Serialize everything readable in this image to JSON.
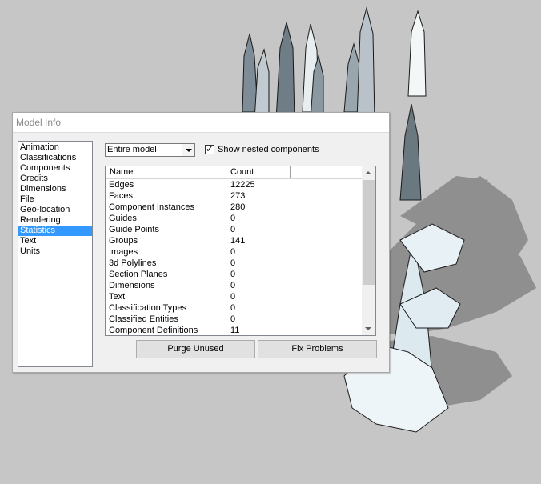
{
  "dialog": {
    "title": "Model Info",
    "sidebar": {
      "items": [
        "Animation",
        "Classifications",
        "Components",
        "Credits",
        "Dimensions",
        "File",
        "Geo-location",
        "Rendering",
        "Statistics",
        "Text",
        "Units"
      ],
      "selected": "Statistics"
    },
    "scope_select": {
      "value": "Entire model"
    },
    "nested_checkbox": {
      "label": "Show nested components",
      "checked": true
    },
    "table": {
      "headers": [
        "Name",
        "Count",
        ""
      ],
      "rows": [
        {
          "name": "Edges",
          "count": "12225"
        },
        {
          "name": "Faces",
          "count": "273"
        },
        {
          "name": "Component Instances",
          "count": "280"
        },
        {
          "name": "Guides",
          "count": "0"
        },
        {
          "name": "Guide Points",
          "count": "0"
        },
        {
          "name": "Groups",
          "count": "141"
        },
        {
          "name": "Images",
          "count": "0"
        },
        {
          "name": "3d Polylines",
          "count": "0"
        },
        {
          "name": "Section Planes",
          "count": "0"
        },
        {
          "name": "Dimensions",
          "count": "0"
        },
        {
          "name": "Text",
          "count": "0"
        },
        {
          "name": "Classification Types",
          "count": "0"
        },
        {
          "name": "Classified Entities",
          "count": "0"
        },
        {
          "name": "Component Definitions",
          "count": "11"
        }
      ]
    },
    "buttons": {
      "purge": "Purge Unused",
      "fix": "Fix Problems"
    }
  },
  "colors": {
    "viewport_bg": "#c6c6c6",
    "selection": "#3399ff",
    "shadow": "#8c8c8c",
    "foliage": "#e4f0f4"
  }
}
